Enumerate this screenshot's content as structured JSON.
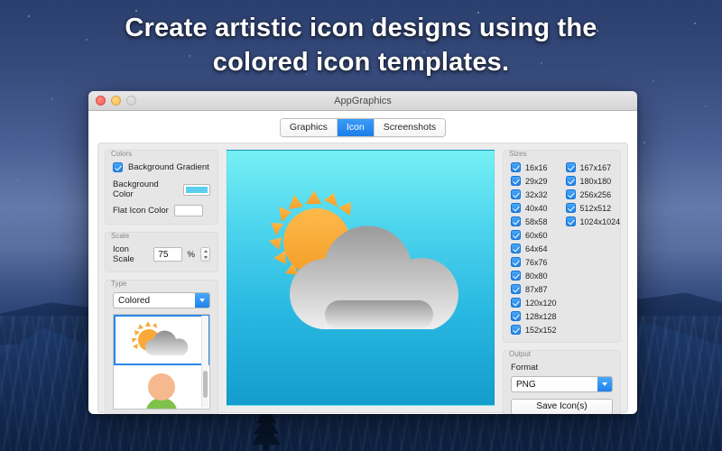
{
  "headline": {
    "line1": "Create artistic icon designs using the",
    "line2": "colored icon templates."
  },
  "window": {
    "title": "AppGraphics",
    "traffic_lights": [
      "close-red",
      "minimize-yellow",
      "zoom-disabled-gray"
    ]
  },
  "tabs": [
    {
      "label": "Graphics",
      "active": false
    },
    {
      "label": "Icon",
      "active": true
    },
    {
      "label": "Screenshots",
      "active": false
    }
  ],
  "colors_group": {
    "title": "Colors",
    "background_gradient_label": "Background Gradient",
    "background_gradient_checked": true,
    "background_color_label": "Background Color",
    "background_color_value": "#5ACFEE",
    "flat_icon_color_label": "Flat Icon Color",
    "flat_icon_color_value": "#FFFFFF"
  },
  "scale_group": {
    "title": "Scale",
    "icon_scale_label": "Icon Scale",
    "icon_scale_value": "75",
    "unit": "%"
  },
  "type_group": {
    "title": "Type",
    "selected_option": "Colored",
    "options": [
      "Colored"
    ],
    "templates": [
      {
        "name": "weather-sun-cloud-template",
        "selected": true
      },
      {
        "name": "person-avatar-template",
        "selected": false
      }
    ]
  },
  "preview": {
    "name": "icon-preview",
    "background_gradient_from": "#76F0F5",
    "background_gradient_to": "#139CCD",
    "icon": "sun-behind-cloud",
    "sun_color": "#F9A93A",
    "cloud_color_top": "#9A9A9A",
    "cloud_color_bottom": "#EDEDED"
  },
  "sizes_group": {
    "title": "Sizes",
    "column1": [
      "16x16",
      "29x29",
      "32x32",
      "40x40",
      "58x58",
      "60x60",
      "64x64",
      "76x76",
      "80x80",
      "87x87",
      "120x120",
      "128x128",
      "152x152"
    ],
    "column2": [
      "167x167",
      "180x180",
      "256x256",
      "512x512",
      "1024x1024"
    ],
    "all_checked": true
  },
  "output_group": {
    "title": "Output",
    "format_label": "Format",
    "format_value": "PNG",
    "format_options": [
      "PNG"
    ],
    "save_button_label": "Save Icon(s)"
  },
  "accent_color": "#1E82EE"
}
